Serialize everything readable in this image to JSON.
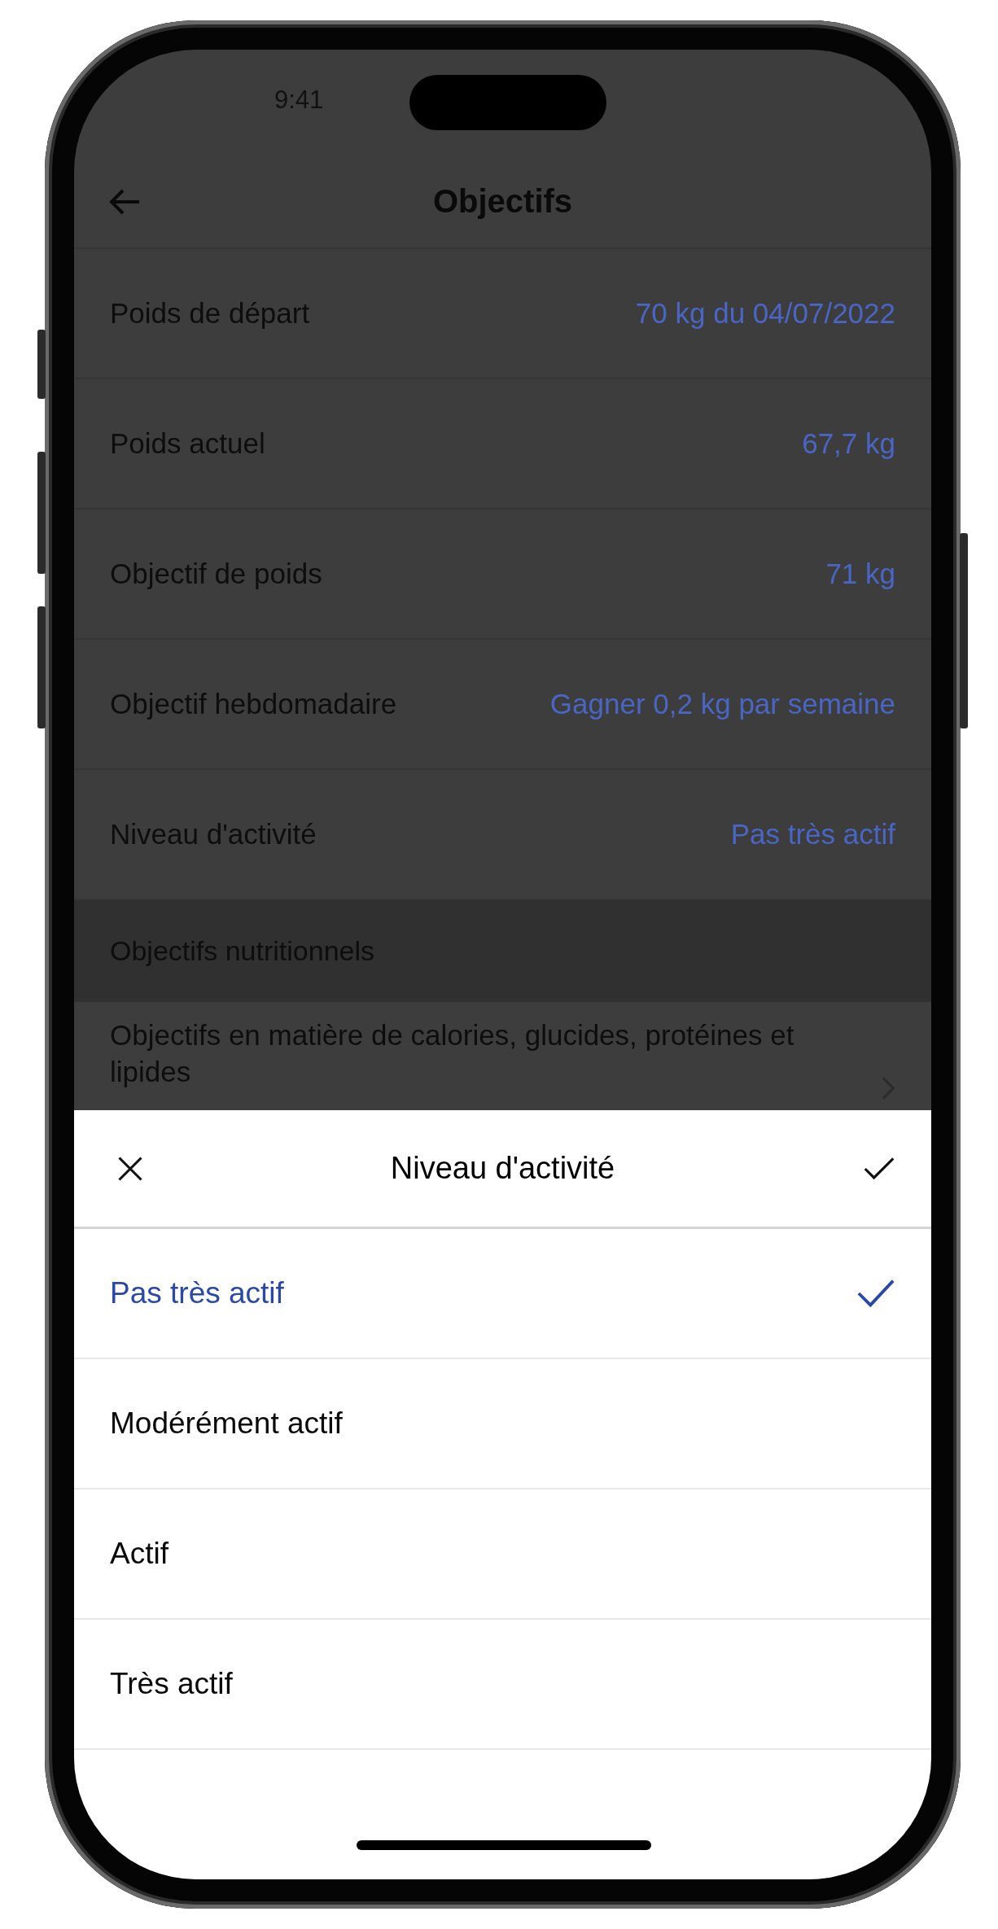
{
  "status_bar": {
    "time": "9:41"
  },
  "nav": {
    "title": "Objectifs"
  },
  "settings": [
    {
      "label": "Poids de départ",
      "value": "70 kg du 04/07/2022"
    },
    {
      "label": "Poids actuel",
      "value": "67,7 kg"
    },
    {
      "label": "Objectif de poids",
      "value": "71 kg"
    },
    {
      "label": "Objectif hebdomadaire",
      "value": "Gagner 0,2 kg par semaine"
    },
    {
      "label": "Niveau d'activité",
      "value": "Pas très actif"
    }
  ],
  "section": {
    "title": "Objectifs nutritionnels"
  },
  "nutrition_row": {
    "title": "Objectifs en matière de calories, glucides, protéines et lipides"
  },
  "sheet": {
    "title": "Niveau d'activité",
    "options": [
      {
        "label": "Pas très actif",
        "selected": true
      },
      {
        "label": "Modérément actif",
        "selected": false
      },
      {
        "label": "Actif",
        "selected": false
      },
      {
        "label": "Très actif",
        "selected": false
      }
    ]
  }
}
